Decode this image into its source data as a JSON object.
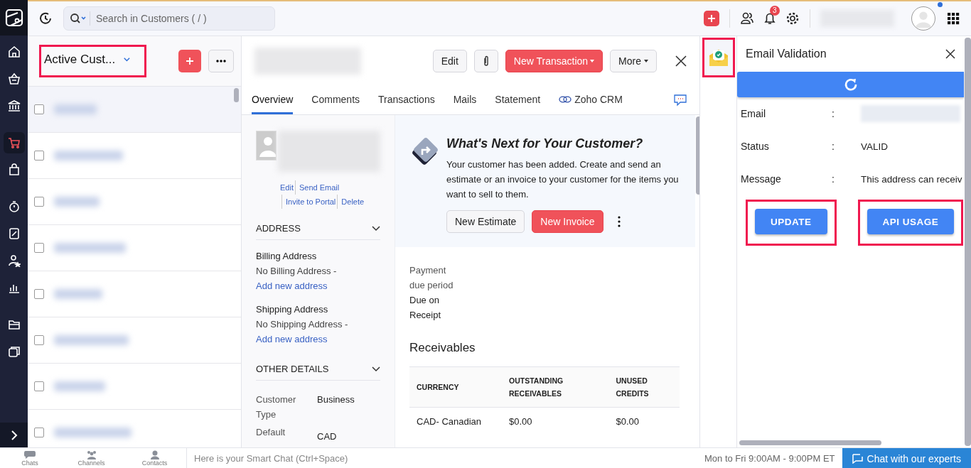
{
  "nav": [
    {
      "kind": "home",
      "selected": false
    },
    {
      "kind": "basket",
      "selected": false
    },
    {
      "kind": "bank",
      "selected": false
    },
    {
      "kind": "cart",
      "selected": true
    },
    {
      "kind": "bag",
      "selected": false
    },
    {
      "kind": "timer",
      "selected": false
    },
    {
      "kind": "percent",
      "selected": false
    },
    {
      "kind": "user",
      "selected": false
    },
    {
      "kind": "chart",
      "selected": false
    },
    {
      "kind": "folder",
      "selected": false
    },
    {
      "kind": "windows",
      "selected": false
    }
  ],
  "search": {
    "placeholder": "Search in Customers ( / )"
  },
  "topbar": {
    "notification_count": "3"
  },
  "list": {
    "title": "Active Cust...",
    "highlighted": true,
    "rows": [
      {
        "selected": true,
        "checked": false
      },
      {
        "selected": false,
        "checked": false
      },
      {
        "selected": false,
        "checked": false
      },
      {
        "selected": false,
        "checked": false
      },
      {
        "selected": false,
        "checked": false
      },
      {
        "selected": false,
        "checked": false
      },
      {
        "selected": false,
        "checked": false
      },
      {
        "selected": false,
        "checked": false
      }
    ]
  },
  "detail": {
    "buttons": [
      "Edit",
      "New Transaction",
      "More"
    ],
    "tabs": [
      {
        "label": "Overview",
        "selected": true
      },
      {
        "label": "Comments",
        "selected": false
      },
      {
        "label": "Transactions",
        "selected": false
      },
      {
        "label": "Mails",
        "selected": false
      },
      {
        "label": "Statement",
        "selected": false
      },
      {
        "label": "Zoho CRM",
        "selected": false
      }
    ],
    "contact_links": [
      "Edit",
      "Send Email",
      "Invite to Portal",
      "Delete"
    ],
    "address_heading": "ADDRESS",
    "addresses": [
      {
        "label": "Billing Address",
        "value": "No Billing Address - ",
        "link": "Add new address"
      },
      {
        "label": "Shipping Address",
        "value": "No Shipping Address - ",
        "link": "Add new address"
      }
    ],
    "other_heading": "OTHER DETAILS",
    "other_details": [
      {
        "label": "Customer Type",
        "value": "Business"
      },
      {
        "label": "Default",
        "value": "CAD"
      }
    ],
    "next_steps": {
      "title": "What's Next for Your Customer?",
      "text": "Your customer has been added. Create and send an estimate or an invoice to your customer for the items you want to sell to them.",
      "buttons": [
        "New Estimate",
        "New Invoice"
      ]
    },
    "payment_label": "Payment due period",
    "payment_value": "Due on Receipt",
    "receivables": {
      "title": "Receivables",
      "columns": [
        "CURRENCY",
        "OUTSTANDING RECEIVABLES",
        "UNUSED CREDITS"
      ],
      "rows": [
        [
          "CAD- Canadian",
          "$0.00",
          "$0.00"
        ]
      ]
    }
  },
  "widget": {
    "highlighted": true
  },
  "email_validation": {
    "title": "Email Validation",
    "fields": [
      {
        "label": "Email",
        "separator": ":"
      },
      {
        "label": "Status",
        "separator": ":",
        "value": "VALID"
      },
      {
        "label": "Message",
        "separator": ":",
        "value": "This address can receiv"
      }
    ],
    "buttons": [
      {
        "label": "UPDATE",
        "highlighted": true
      },
      {
        "label": "API USAGE",
        "highlighted": true
      }
    ]
  },
  "bottom": {
    "tabs": [
      "Chats",
      "Channels",
      "Contacts"
    ],
    "chat_placeholder": "Here is your Smart Chat (Ctrl+Space)",
    "hours": "Mon to Fri 9:00AM - 9:00PM ET",
    "chat_button": "Chat with our experts"
  }
}
